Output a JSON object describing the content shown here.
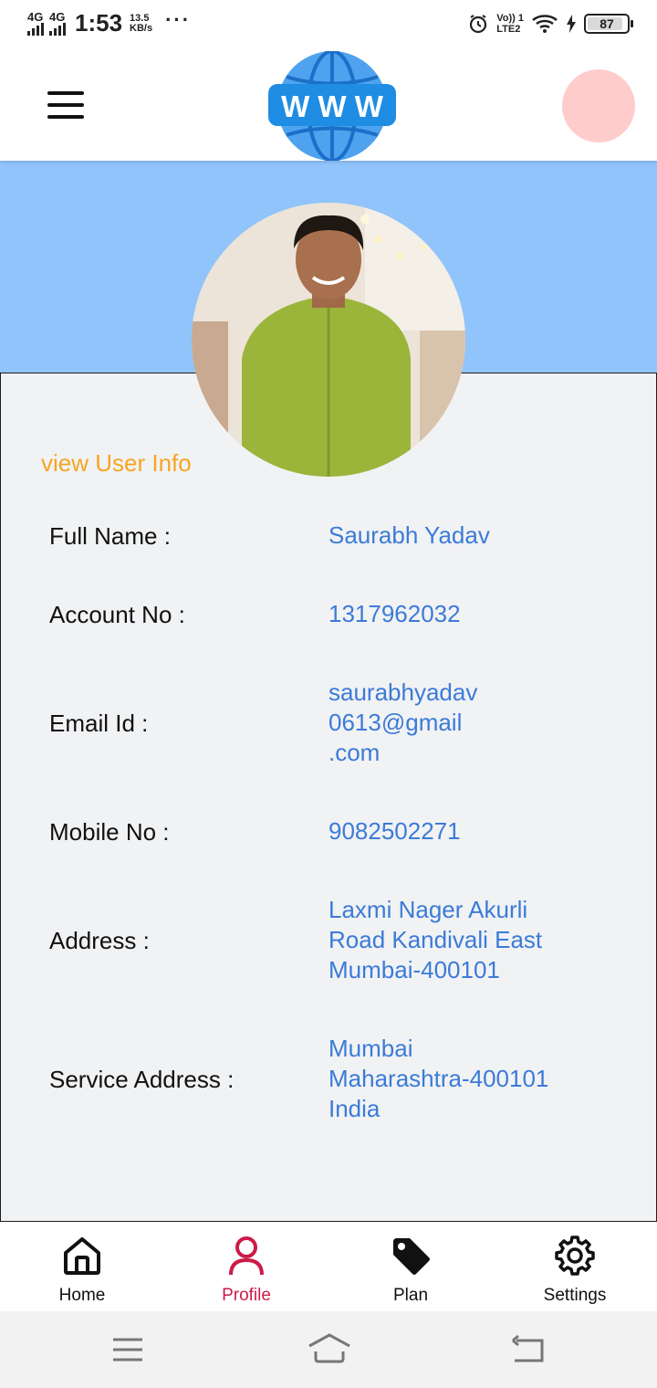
{
  "status_bar": {
    "network_1": "4G",
    "network_2": "4G",
    "time": "1:53",
    "speed_value": "13.5",
    "speed_unit": "KB/s",
    "more": "···",
    "volte_top": "Vo)) 1",
    "volte_bottom": "LTE2",
    "battery": "87"
  },
  "header": {
    "logo_text": "W W W"
  },
  "profile": {
    "section_title": "view User Info",
    "rows": [
      {
        "label": "Full Name :",
        "value": [
          "Saurabh Yadav"
        ]
      },
      {
        "label": "Account No :",
        "value": [
          "1317962032"
        ]
      },
      {
        "label": "Email Id :",
        "value": [
          "saurabhyadav",
          "0613@gmail",
          ".com"
        ]
      },
      {
        "label": "Mobile No :",
        "value": [
          "9082502271"
        ]
      },
      {
        "label": "Address :",
        "value": [
          "Laxmi Nager Akurli",
          "Road Kandivali East",
          "Mumbai-400101"
        ]
      },
      {
        "label": "Service Address :",
        "value": [
          "Mumbai",
          "Maharashtra-400101",
          "India"
        ]
      }
    ]
  },
  "bottom_nav": {
    "items": [
      {
        "label": "Home",
        "icon": "home-icon"
      },
      {
        "label": "Profile",
        "icon": "user-icon",
        "active": true
      },
      {
        "label": "Plan",
        "icon": "tag-icon"
      },
      {
        "label": "Settings",
        "icon": "gear-icon"
      }
    ]
  },
  "colors": {
    "banner": "#90c4fb",
    "value_text": "#3b7bd8",
    "section_title": "#f5a623",
    "active_nav": "#cc1b48",
    "avatar_placeholder": "#ffcccc"
  }
}
